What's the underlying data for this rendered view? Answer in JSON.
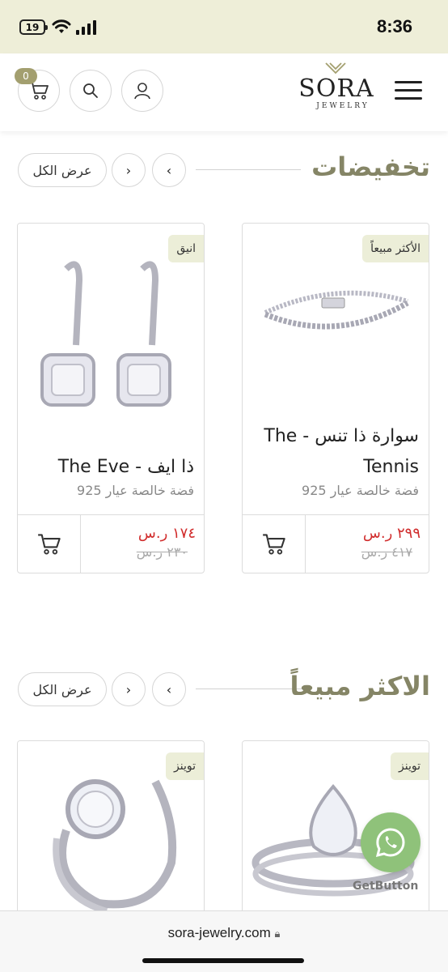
{
  "status_bar": {
    "battery": "19",
    "time": "8:36"
  },
  "header": {
    "cart_count": "0",
    "logo_main": "SORA",
    "logo_sub": "JEWELRY"
  },
  "sections": [
    {
      "title": "تخفيضات",
      "view_all": "عرض الكل",
      "products": [
        {
          "badge": "الأكثر مبيعاً",
          "name": "سوارة ذا تنس - The Tennis",
          "desc": "فضة خالصة عيار 925",
          "price_new": "٢٩٩ ر.س",
          "price_old": "٤١٧ ر.س",
          "image": "bracelet"
        },
        {
          "badge": "انيق",
          "name": "ذا ايف - The Eve",
          "desc": "فضة خالصة عيار 925",
          "price_new": "١٧٤ ر.س",
          "price_old": "٢٣٠ ر.س",
          "image": "earrings"
        }
      ]
    },
    {
      "title": "الاكثر مبيعاً",
      "view_all": "عرض الكل",
      "products": [
        {
          "badge": "توينز",
          "image": "pear-ring"
        },
        {
          "badge": "توينز",
          "image": "round-ring"
        }
      ]
    }
  ],
  "whatsapp": {
    "label": "GetButton"
  },
  "url_bar": {
    "url": "sora-jewelry.com"
  },
  "colors": {
    "accent": "#858566",
    "badge_bg": "#eceed8",
    "sale_price": "#d12d2d",
    "status_bar": "#eeeed8"
  }
}
